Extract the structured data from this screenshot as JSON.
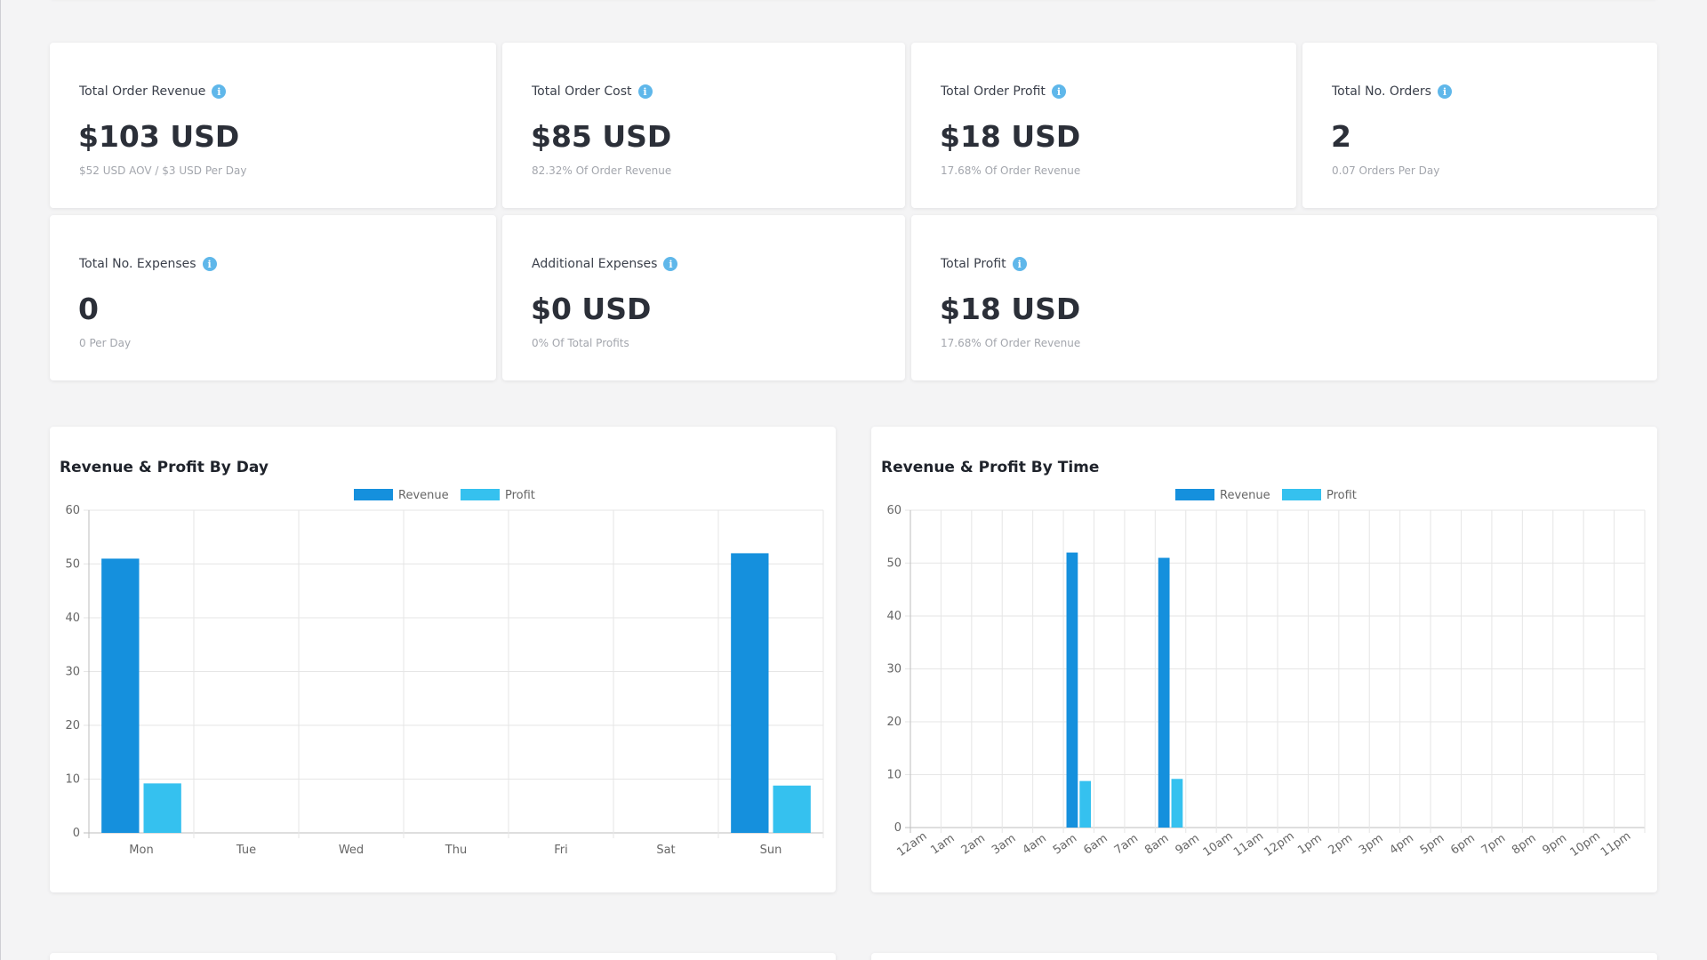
{
  "colors": {
    "revenue": "#1590dd",
    "profit": "#35c1ef",
    "info": "#5fb7ea"
  },
  "stats": [
    {
      "title": "Total Order Revenue",
      "value": "$103 USD",
      "sub": "$52 USD AOV / $3 USD Per Day"
    },
    {
      "title": "Total Order Cost",
      "value": "$85 USD",
      "sub": "82.32% Of Order Revenue"
    },
    {
      "title": "Total Order Profit",
      "value": "$18 USD",
      "sub": "17.68% Of Order Revenue"
    },
    {
      "title": "Total No. Orders",
      "value": "2",
      "sub": "0.07 Orders Per Day"
    },
    {
      "title": "Total No. Expenses",
      "value": "0",
      "sub": "0 Per Day"
    },
    {
      "title": "Additional Expenses",
      "value": "$0 USD",
      "sub": "0% Of Total Profits"
    },
    {
      "title": "Total Profit",
      "value": "$18 USD",
      "sub": "17.68% Of Order Revenue"
    }
  ],
  "info_glyph": "i",
  "chart_data": [
    {
      "type": "bar",
      "title": "Revenue & Profit By Day",
      "categories": [
        "Mon",
        "Tue",
        "Wed",
        "Thu",
        "Fri",
        "Sat",
        "Sun"
      ],
      "series": [
        {
          "name": "Revenue",
          "values": [
            51,
            0,
            0,
            0,
            0,
            0,
            52
          ]
        },
        {
          "name": "Profit",
          "values": [
            9.2,
            0,
            0,
            0,
            0,
            0,
            8.8
          ]
        }
      ],
      "ylim": [
        0,
        60
      ],
      "yticks": [
        "0",
        "10",
        "20",
        "30",
        "40",
        "50",
        "60"
      ],
      "grid": true,
      "legend": "top-center"
    },
    {
      "type": "bar",
      "title": "Revenue & Profit By Time",
      "categories": [
        "12am",
        "1am",
        "2am",
        "3am",
        "4am",
        "5am",
        "6am",
        "7am",
        "8am",
        "9am",
        "10am",
        "11am",
        "12pm",
        "1pm",
        "2pm",
        "3pm",
        "4pm",
        "5pm",
        "6pm",
        "7pm",
        "8pm",
        "9pm",
        "10pm",
        "11pm"
      ],
      "series": [
        {
          "name": "Revenue",
          "values": [
            0,
            0,
            0,
            0,
            0,
            52,
            0,
            0,
            51,
            0,
            0,
            0,
            0,
            0,
            0,
            0,
            0,
            0,
            0,
            0,
            0,
            0,
            0,
            0
          ]
        },
        {
          "name": "Profit",
          "values": [
            0,
            0,
            0,
            0,
            0,
            8.8,
            0,
            0,
            9.2,
            0,
            0,
            0,
            0,
            0,
            0,
            0,
            0,
            0,
            0,
            0,
            0,
            0,
            0,
            0
          ]
        }
      ],
      "ylim": [
        0,
        60
      ],
      "yticks": [
        "0",
        "10",
        "20",
        "30",
        "40",
        "50",
        "60"
      ],
      "grid": true,
      "legend": "top-center"
    }
  ]
}
